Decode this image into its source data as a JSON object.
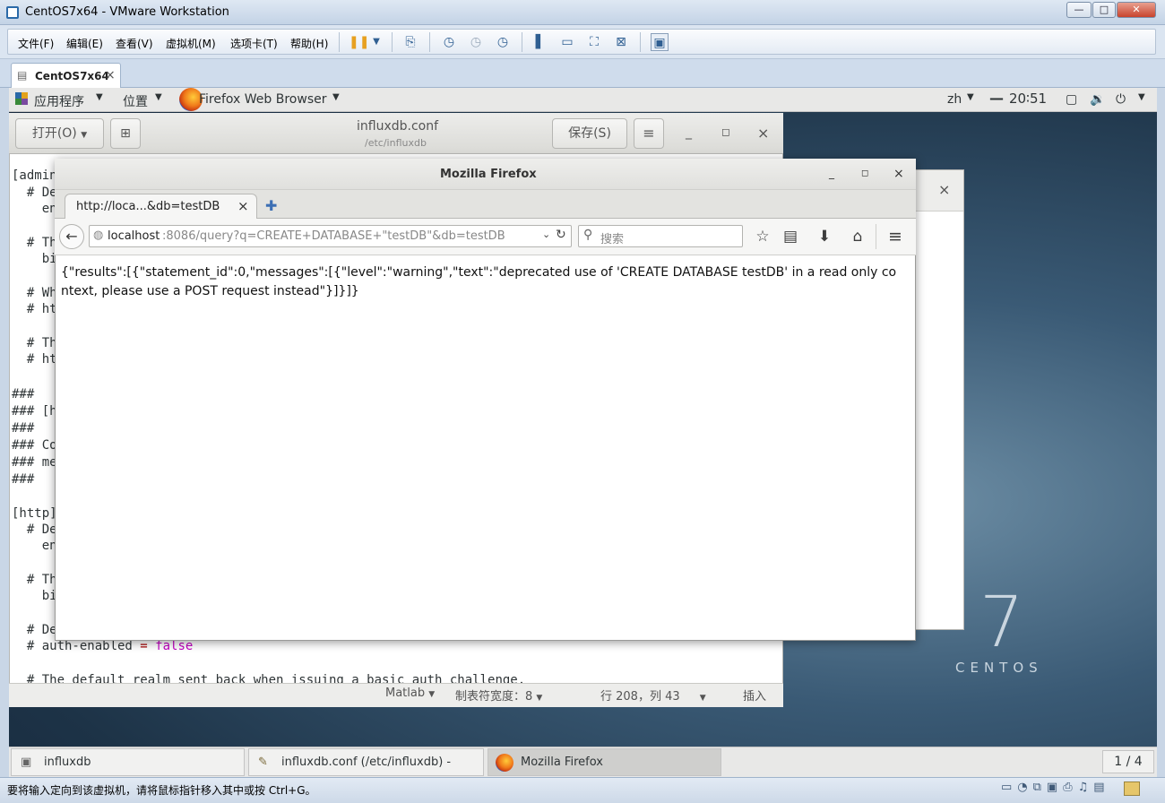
{
  "vmware": {
    "title": "CentOS7x64 - VMware Workstation",
    "menu": [
      "文件(F)",
      "编辑(E)",
      "查看(V)",
      "虚拟机(M)",
      "选项卡(T)",
      "帮助(H)"
    ],
    "tab_label": "CentOS7x64",
    "tab_close": "×",
    "window_min": "—",
    "window_max": "□",
    "window_close": "✕",
    "status_text": "要将输入定向到该虚拟机，请将鼠标指针移入其中或按 Ctrl+G。"
  },
  "gnome": {
    "apps": "应用程序",
    "places": "位置",
    "active_app": "Firefox Web Browser",
    "lang": "zh",
    "clock": "20∶51"
  },
  "gedit": {
    "open_button": "打开(O)",
    "title": "influxdb.conf",
    "path": "/etc/influxdb",
    "save_button": "保存(S)",
    "lines": [
      "[admin]",
      "  # De",
      "    en",
      "",
      "  # Th",
      "    bi",
      "",
      "  # Wh",
      "  # ht",
      "",
      "  # Th",
      "  # ht",
      "",
      "###",
      "### [h",
      "###",
      "### Co",
      "### me",
      "###",
      "",
      "[http]",
      "  # De",
      "    en",
      "",
      "  # Th",
      "    bi",
      "",
      "  # De",
      "  # auth-enabled ",
      "",
      "  # The default realm sent back when issuing a basic auth challenge."
    ],
    "auth_eq": "=",
    "auth_value": "false",
    "status": {
      "language": "Matlab",
      "tab_width": "制表符宽度：8",
      "position": "行 208，列 43",
      "mode": "插入"
    }
  },
  "firefox": {
    "window_title": "Mozilla Firefox",
    "tab_title": "http://loca...&db=testDB",
    "url_host": "localhost",
    "url_rest": ":8086/query?q=CREATE+DATABASE+\"testDB\"&db=testDB",
    "search_placeholder": "搜索",
    "body_text": "{\"results\":[{\"statement_id\":0,\"messages\":[{\"level\":\"warning\",\"text\":\"deprecated use of 'CREATE DATABASE testDB' in a read only context, please use a POST request instead\"}]}]}"
  },
  "taskbar": {
    "items": [
      "influxdb",
      "influxdb.conf (/etc/influxdb) - gedit",
      "Mozilla Firefox"
    ],
    "workspace": "1 / 4"
  },
  "desktop": {
    "logo_number": "7",
    "logo_text": "CENTOS"
  },
  "colors": {
    "false_literal": "#c000c0",
    "vmware_accent": "#2b6aa8"
  }
}
